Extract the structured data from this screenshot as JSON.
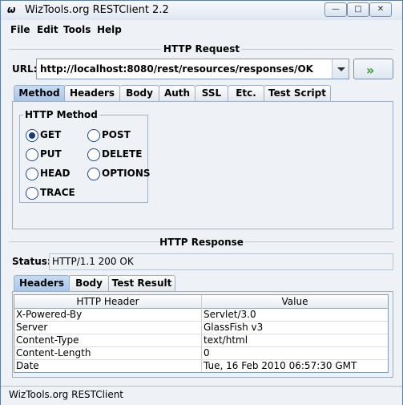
{
  "window": {
    "title": "WizTools.org RESTClient 2.2",
    "app_icon": "ω",
    "buttons": {
      "minimize": "—",
      "maximize": "□",
      "close": "✕"
    }
  },
  "menubar": {
    "items": [
      {
        "label": "File"
      },
      {
        "label": "Edit"
      },
      {
        "label": "Tools"
      },
      {
        "label": "Help"
      }
    ]
  },
  "request": {
    "title": "HTTP Request",
    "url_label": "URL:",
    "url_value": "http://localhost:8080/rest/resources/responses/OK",
    "go_symbol": "»",
    "tabs": [
      {
        "label": "Method",
        "active": true
      },
      {
        "label": "Headers"
      },
      {
        "label": "Body"
      },
      {
        "label": "Auth"
      },
      {
        "label": "SSL"
      },
      {
        "label": "Etc."
      },
      {
        "label": "Test Script"
      }
    ],
    "method_group": {
      "title": "HTTP Method",
      "options": [
        {
          "label": "GET",
          "selected": true
        },
        {
          "label": "POST",
          "selected": false
        },
        {
          "label": "PUT",
          "selected": false
        },
        {
          "label": "DELETE",
          "selected": false
        },
        {
          "label": "HEAD",
          "selected": false
        },
        {
          "label": "OPTIONS",
          "selected": false
        },
        {
          "label": "TRACE",
          "selected": false
        }
      ]
    }
  },
  "response": {
    "title": "HTTP Response",
    "status_label": "Status:",
    "status_value": "HTTP/1.1 200 OK",
    "tabs": [
      {
        "label": "Headers",
        "active": true
      },
      {
        "label": "Body"
      },
      {
        "label": "Test Result"
      }
    ],
    "table": {
      "columns": [
        "HTTP Header",
        "Value"
      ],
      "rows": [
        [
          "X-Powered-By",
          "Servlet/3.0"
        ],
        [
          "Server",
          "GlassFish v3"
        ],
        [
          "Content-Type",
          "text/html"
        ],
        [
          "Content-Length",
          "0"
        ],
        [
          "Date",
          "Tue, 16 Feb 2010 06:57:30 GMT"
        ]
      ]
    }
  },
  "statusbar": {
    "text": "WizTools.org RESTClient"
  }
}
